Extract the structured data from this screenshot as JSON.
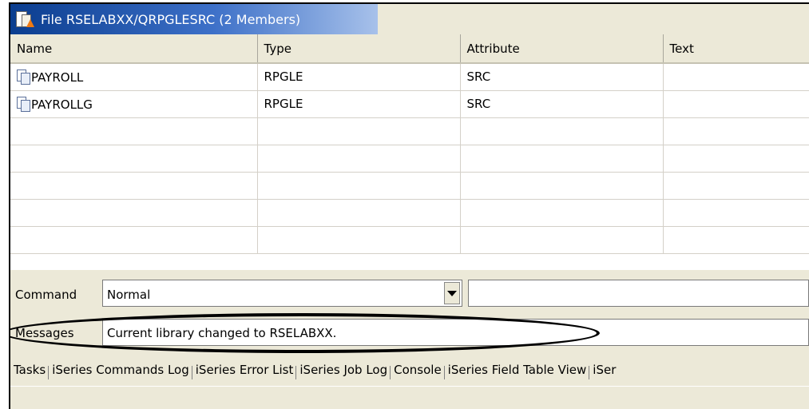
{
  "window": {
    "title": "File RSELABXX/QRPGLESRC (2 Members)",
    "icon": "file-folder-icon"
  },
  "table": {
    "columns": [
      "Name",
      "Type",
      "Attribute",
      "Text"
    ],
    "rows": [
      {
        "name": "PAYROLL",
        "type": "RPGLE",
        "attribute": "SRC",
        "text": ""
      },
      {
        "name": "PAYROLLG",
        "type": "RPGLE",
        "attribute": "SRC",
        "text": ""
      }
    ],
    "member_icon": "source-member-icon"
  },
  "command": {
    "label": "Command",
    "mode": "Normal",
    "input": ""
  },
  "messages": {
    "label": "Messages",
    "text": "Current library changed to RSELABXX."
  },
  "tabs": [
    "Tasks",
    "iSeries Commands Log",
    "iSeries Error List",
    "iSeries Job Log",
    "Console",
    "iSeries Field Table View",
    "iSer"
  ]
}
